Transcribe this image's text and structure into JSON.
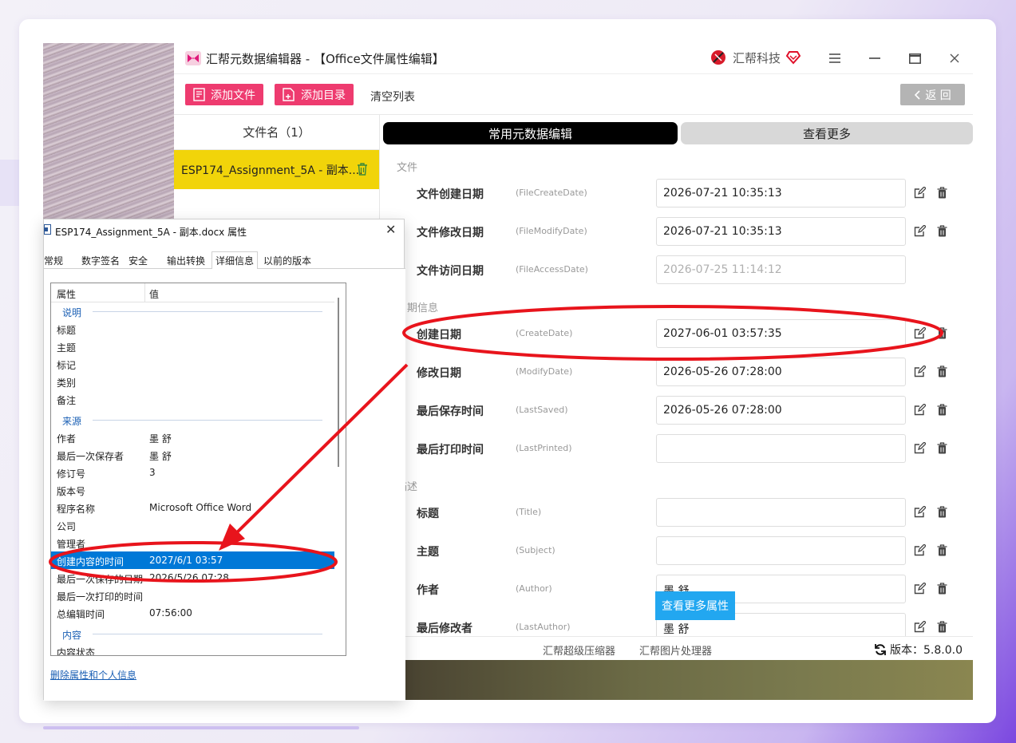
{
  "window": {
    "title": "汇帮元数据编辑器 - 【Office文件属性编辑】",
    "brand": "汇帮科技"
  },
  "toolbar": {
    "add_file": "添加文件",
    "add_dir": "添加目录",
    "clear": "清空列表",
    "back": "返 回"
  },
  "file_list": {
    "header": "文件名（1）",
    "items": [
      {
        "name": "ESP174_Assignment_5A - 副本...."
      }
    ]
  },
  "tabs": {
    "common": "常用元数据编辑",
    "more": "查看更多"
  },
  "sections": {
    "file": "文件",
    "date": "日期信息",
    "desc": "描述"
  },
  "fields": [
    {
      "label": "文件创建日期",
      "key": "(FileCreateDate)",
      "value": "2026-07-21 10:35:13"
    },
    {
      "label": "文件修改日期",
      "key": "(FileModifyDate)",
      "value": "2026-07-21 10:35:13"
    },
    {
      "label": "文件访问日期",
      "key": "(FileAccessDate)",
      "value": "2026-07-25 11:14:12"
    },
    {
      "label": "创建日期",
      "key": "(CreateDate)",
      "value": "2027-06-01 03:57:35"
    },
    {
      "label": "修改日期",
      "key": "(ModifyDate)",
      "value": "2026-05-26 07:28:00"
    },
    {
      "label": "最后保存时间",
      "key": "(LastSaved)",
      "value": "2026-05-26 07:28:00"
    },
    {
      "label": "最后打印时间",
      "key": "(LastPrinted)",
      "value": ""
    },
    {
      "label": "标题",
      "key": "(Title)",
      "value": ""
    },
    {
      "label": "主题",
      "key": "(Subject)",
      "value": ""
    },
    {
      "label": "作者",
      "key": "(Author)",
      "value": "墨 舒"
    },
    {
      "label": "最后修改者",
      "key": "(LastAuthor)",
      "value": "墨 舒"
    }
  ],
  "more_props_button": "查看更多属性",
  "footer": {
    "compressor": "汇帮超级压缩器",
    "image_tool": "汇帮图片处理器",
    "version": "版本：5.8.0.0"
  },
  "dialog": {
    "title": "ESP174_Assignment_5A - 副本.docx 属性",
    "tabs": [
      "常规",
      "数字签名",
      "安全",
      "输出转换",
      "详细信息",
      "以前的版本"
    ],
    "header": {
      "prop": "属性",
      "value": "值"
    },
    "groups": {
      "desc": "说明",
      "source": "来源",
      "content": "内容"
    },
    "rows": [
      {
        "k": "标题",
        "v": ""
      },
      {
        "k": "主题",
        "v": ""
      },
      {
        "k": "标记",
        "v": ""
      },
      {
        "k": "类别",
        "v": ""
      },
      {
        "k": "备注",
        "v": ""
      },
      {
        "k": "作者",
        "v": "墨 舒"
      },
      {
        "k": "最后一次保存者",
        "v": "墨 舒"
      },
      {
        "k": "修订号",
        "v": "3"
      },
      {
        "k": "版本号",
        "v": ""
      },
      {
        "k": "程序名称",
        "v": "Microsoft Office Word"
      },
      {
        "k": "公司",
        "v": ""
      },
      {
        "k": "管理者",
        "v": ""
      },
      {
        "k": "创建内容的时间",
        "v": "2027/6/1 03:57"
      },
      {
        "k": "最后一次保存的日期",
        "v": "2026/5/26 07:28"
      },
      {
        "k": "最后一次打印的时间",
        "v": ""
      },
      {
        "k": "总编辑时间",
        "v": "07:56:00"
      },
      {
        "k": "内容状态",
        "v": ""
      }
    ],
    "remove_link": "删除属性和个人信息"
  },
  "colors": {
    "accent_pink": "#ee3b6f",
    "highlight_yellow": "#f1d40a",
    "annotation_red": "#e8141c",
    "selection_blue": "#0078d7"
  }
}
